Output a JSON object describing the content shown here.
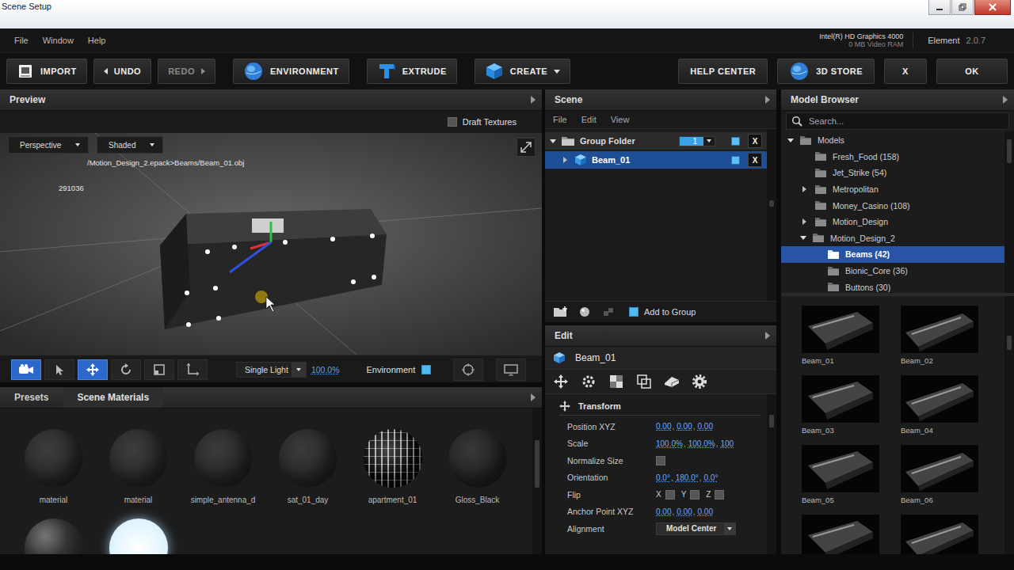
{
  "window": {
    "title": "Scene Setup"
  },
  "menu": [
    "File",
    "Window",
    "Help"
  ],
  "gpu": {
    "name": "Intel(R) HD Graphics 4000",
    "memory": "0 MB Video RAM"
  },
  "app": {
    "name": "Element",
    "version": "2.0.7"
  },
  "toolbar": {
    "groups": [
      [
        {
          "label": "IMPORT",
          "kind": "import",
          "disabled": false
        },
        {
          "label": "UNDO",
          "kind": "undo",
          "disabled": false
        },
        {
          "label": "REDO",
          "kind": "redo",
          "disabled": true
        }
      ],
      [
        {
          "label": "ENVIRONMENT",
          "kind": "globe",
          "disabled": false
        }
      ],
      [
        {
          "label": "EXTRUDE",
          "kind": "extrude",
          "disabled": false
        }
      ],
      [
        {
          "label": "CREATE",
          "kind": "create",
          "disabled": false
        }
      ]
    ],
    "right": [
      {
        "label": "HELP CENTER",
        "kind": "text"
      },
      {
        "label": "3D STORE",
        "kind": "globe"
      },
      {
        "label": "X",
        "kind": "text"
      },
      {
        "label": "OK",
        "kind": "text"
      }
    ]
  },
  "preview": {
    "title": "Preview",
    "draft_textures": {
      "label": "Draft Textures",
      "checked": false
    },
    "view_mode": "Perspective",
    "shading": "Shaded",
    "path": "/Motion_Design_2.epack>Beams/Beam_01.obj",
    "count": "291036",
    "tools": [
      {
        "kind": "camera",
        "selected": true
      },
      {
        "kind": "select",
        "selected": false
      },
      {
        "kind": "move",
        "selected": true
      },
      {
        "kind": "rotate",
        "selected": false
      },
      {
        "kind": "scale",
        "selected": false
      },
      {
        "kind": "axis",
        "selected": false
      }
    ],
    "light": "Single Light",
    "light_level": "100.0%",
    "environment": {
      "label": "Environment",
      "checked": true
    }
  },
  "materials": {
    "tabs": [
      {
        "label": "Presets",
        "selected": false
      },
      {
        "label": "Scene Materials",
        "selected": true
      }
    ],
    "items": [
      {
        "name": "material",
        "kind": "matte",
        "color": "#2c2c2c"
      },
      {
        "name": "material",
        "kind": "matte",
        "color": "#2c2c2c"
      },
      {
        "name": "simple_antenna_d",
        "kind": "matte",
        "color": "#2a2a2a"
      },
      {
        "name": "sat_01_day",
        "kind": "matte",
        "color": "#2a2a2a"
      },
      {
        "name": "apartment_01",
        "kind": "pattern",
        "color": "#0a0a0a"
      },
      {
        "name": "Gloss_Black",
        "kind": "matte",
        "color": "#262626"
      },
      {
        "kind": "glossy",
        "color": "#3a3a3a"
      },
      {
        "kind": "glow",
        "color": "#e6f6ff"
      }
    ]
  },
  "scene": {
    "title": "Scene",
    "menu": [
      "File",
      "Edit",
      "View"
    ],
    "tree": [
      {
        "label": "Group Folder",
        "kind": "folder",
        "depth": 0,
        "expanded": true,
        "selected": false,
        "count": "1",
        "visible": true,
        "remove": "X"
      },
      {
        "label": "Beam_01",
        "kind": "object",
        "depth": 1,
        "expanded": false,
        "selected": true,
        "visible": true,
        "remove": "X"
      }
    ],
    "add_to_group": {
      "label": "Add to Group",
      "checked": true
    }
  },
  "edit": {
    "title": "Edit",
    "object": "Beam_01",
    "section": "Transform",
    "separator": ",",
    "fields": [
      {
        "label": "Position XYZ",
        "kind": "triple",
        "values": [
          "0.00",
          "0.00",
          "0.00"
        ]
      },
      {
        "label": "Scale",
        "kind": "triple",
        "values": [
          "100.0%",
          "100.0%",
          "100"
        ]
      },
      {
        "label": "Normalize Size",
        "kind": "checkbox",
        "checked": false
      },
      {
        "label": "Orientation",
        "kind": "triple",
        "values": [
          "0.0°",
          "180.0°",
          "0.0°"
        ]
      },
      {
        "label": "Flip",
        "kind": "flags",
        "flags": [
          {
            "label": "X",
            "checked": false
          },
          {
            "label": "Y",
            "checked": false
          },
          {
            "label": "Z",
            "checked": false
          }
        ]
      },
      {
        "label": "Anchor Point XYZ",
        "kind": "triple",
        "values": [
          "0.00",
          "0.00",
          "0.00"
        ]
      },
      {
        "label": "Alignment",
        "kind": "select",
        "value": "Model Center"
      }
    ]
  },
  "model_browser": {
    "title": "Model Browser",
    "search_placeholder": "Search...",
    "tree": [
      {
        "label": "Models",
        "depth": 0,
        "expandable": true,
        "expanded": true,
        "selected": false
      },
      {
        "label": "Fresh_Food (158)",
        "depth": 1,
        "expandable": false,
        "expanded": false,
        "selected": false
      },
      {
        "label": "Jet_Strike (54)",
        "depth": 1,
        "expandable": false,
        "expanded": false,
        "selected": false
      },
      {
        "label": "Metropolitan",
        "depth": 1,
        "expandable": true,
        "expanded": false,
        "selected": false
      },
      {
        "label": "Money_Casino (108)",
        "depth": 1,
        "expandable": false,
        "expanded": false,
        "selected": false
      },
      {
        "label": "Motion_Design",
        "depth": 1,
        "expandable": true,
        "expanded": false,
        "selected": false
      },
      {
        "label": "Motion_Design_2",
        "depth": 1,
        "expandable": true,
        "expanded": true,
        "selected": false
      },
      {
        "label": "Beams (42)",
        "depth": 2,
        "expandable": false,
        "expanded": false,
        "selected": true
      },
      {
        "label": "Bionic_Core (36)",
        "depth": 2,
        "expandable": false,
        "expanded": false,
        "selected": false
      },
      {
        "label": "Buttons (30)",
        "depth": 2,
        "expandable": false,
        "expanded": false,
        "selected": false
      }
    ],
    "thumbnails": [
      {
        "label": "Beam_01"
      },
      {
        "label": "Beam_02"
      },
      {
        "label": "Beam_03"
      },
      {
        "label": "Beam_04"
      },
      {
        "label": "Beam_05"
      },
      {
        "label": "Beam_06"
      },
      {},
      {}
    ]
  }
}
